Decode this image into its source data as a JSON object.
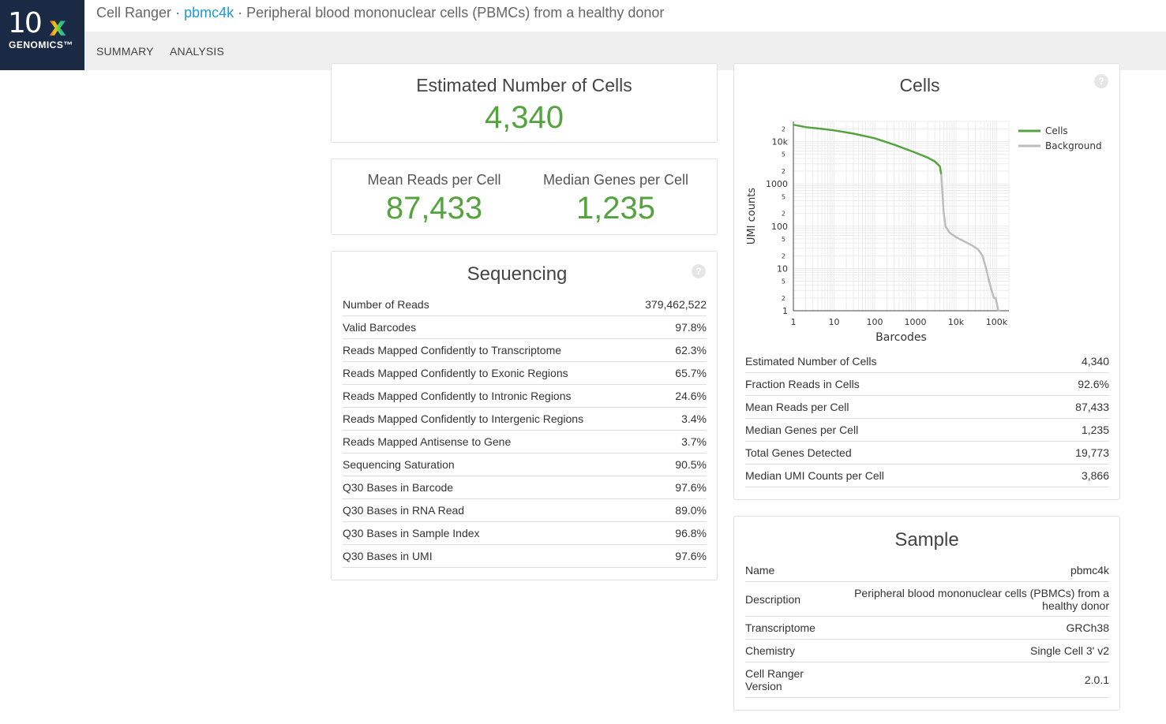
{
  "header": {
    "product": "Cell Ranger",
    "separator": "·",
    "sample_link": "pbmc4k",
    "description": "Peripheral blood mononuclear cells (PBMCs) from a healthy donor"
  },
  "logo": {
    "ten": "10",
    "x": "x",
    "genomics": "GENOMICS™"
  },
  "nav": {
    "tabs": [
      "SUMMARY",
      "ANALYSIS"
    ]
  },
  "estimated_cells": {
    "title": "Estimated Number of Cells",
    "value": "4,340"
  },
  "key_metrics": [
    {
      "label": "Mean Reads per Cell",
      "value": "87,433"
    },
    {
      "label": "Median Genes per Cell",
      "value": "1,235"
    }
  ],
  "sequencing": {
    "title": "Sequencing",
    "help_icon": "question-circle-icon",
    "rows": [
      {
        "label": "Number of Reads",
        "value": "379,462,522"
      },
      {
        "label": "Valid Barcodes",
        "value": "97.8%"
      },
      {
        "label": "Reads Mapped Confidently to Transcriptome",
        "value": "62.3%"
      },
      {
        "label": "Reads Mapped Confidently to Exonic Regions",
        "value": "65.7%"
      },
      {
        "label": "Reads Mapped Confidently to Intronic Regions",
        "value": "24.6%"
      },
      {
        "label": "Reads Mapped Confidently to Intergenic Regions",
        "value": "3.4%"
      },
      {
        "label": "Reads Mapped Antisense to Gene",
        "value": "3.7%"
      },
      {
        "label": "Sequencing Saturation",
        "value": "90.5%"
      },
      {
        "label": "Q30 Bases in Barcode",
        "value": "97.6%"
      },
      {
        "label": "Q30 Bases in RNA Read",
        "value": "89.0%"
      },
      {
        "label": "Q30 Bases in Sample Index",
        "value": "96.8%"
      },
      {
        "label": "Q30 Bases in UMI",
        "value": "97.6%"
      }
    ]
  },
  "cells": {
    "title": "Cells",
    "help_icon": "question-circle-icon",
    "rows": [
      {
        "label": "Estimated Number of Cells",
        "value": "4,340"
      },
      {
        "label": "Fraction Reads in Cells",
        "value": "92.6%"
      },
      {
        "label": "Mean Reads per Cell",
        "value": "87,433"
      },
      {
        "label": "Median Genes per Cell",
        "value": "1,235"
      },
      {
        "label": "Total Genes Detected",
        "value": "19,773"
      },
      {
        "label": "Median UMI Counts per Cell",
        "value": "3,866"
      }
    ]
  },
  "sample": {
    "title": "Sample",
    "rows": [
      {
        "label": "Name",
        "value": "pbmc4k"
      },
      {
        "label": "Description",
        "value": "Peripheral blood mononuclear cells (PBMCs) from a healthy donor"
      },
      {
        "label": "Transcriptome",
        "value": "GRCh38"
      },
      {
        "label": "Chemistry",
        "value": "Single Cell 3' v2"
      },
      {
        "label": "Cell Ranger Version",
        "value": "2.0.1"
      }
    ]
  },
  "chart_data": {
    "type": "line",
    "title": "Cells",
    "xlabel": "Barcodes",
    "ylabel": "UMI counts",
    "x_scale": "log",
    "y_scale": "log",
    "xlim": [
      1,
      200000
    ],
    "ylim": [
      1,
      30000
    ],
    "x_ticks": [
      "1",
      "10",
      "100",
      "1000",
      "10k",
      "100k"
    ],
    "y_ticks": [
      "1",
      "10",
      "100",
      "1000",
      "10k"
    ],
    "y_minor_labels": [
      "2",
      "5"
    ],
    "grid": true,
    "legend": "top-right",
    "series": [
      {
        "name": "Cells",
        "color": "#54a33e",
        "x": [
          1,
          2,
          5,
          10,
          30,
          100,
          300,
          1000,
          2000,
          3000,
          4000,
          4340
        ],
        "y": [
          25000,
          22000,
          20000,
          18500,
          15500,
          12000,
          8500,
          5500,
          4200,
          3400,
          2600,
          1700
        ]
      },
      {
        "name": "Background",
        "color": "#bdbdbd",
        "x": [
          4340,
          4600,
          5000,
          5500,
          7000,
          10000,
          15000,
          25000,
          35000,
          45000,
          55000,
          65000,
          75000,
          85000,
          95000,
          110000,
          120000
        ],
        "y": [
          1700,
          700,
          200,
          100,
          70,
          55,
          45,
          35,
          28,
          20,
          10,
          5,
          3,
          2,
          2,
          1,
          1
        ]
      }
    ]
  }
}
